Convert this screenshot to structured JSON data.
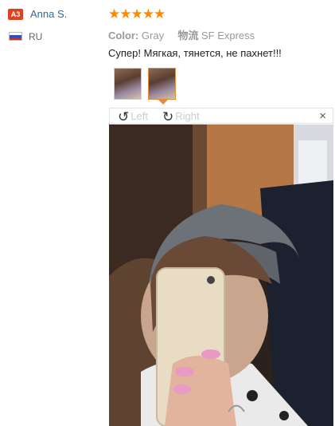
{
  "reviewer": {
    "badge": "A3",
    "name": "Anna S.",
    "country": "RU",
    "flag_colors": [
      "#ffffff",
      "#2a52be",
      "#d52b1e"
    ]
  },
  "rating": {
    "stars": "★★★★★",
    "value": 5,
    "max": 5,
    "color": "#ff8a00"
  },
  "order": {
    "color_label": "Color:",
    "color_value": "Gray",
    "shipping_label": "物流",
    "shipping_value": "SF Express"
  },
  "review_text": "Супер! Мягкая, тянется, не пахнет!!!",
  "thumbnails": [
    {
      "name": "thumb-1",
      "active": false
    },
    {
      "name": "thumb-2",
      "active": true
    }
  ],
  "viewer": {
    "rotate_left_icon": "rotate-left-icon",
    "rotate_left_label": "Left",
    "rotate_right_icon": "rotate-right-icon",
    "rotate_right_label": "Right",
    "close_glyph": "×"
  }
}
